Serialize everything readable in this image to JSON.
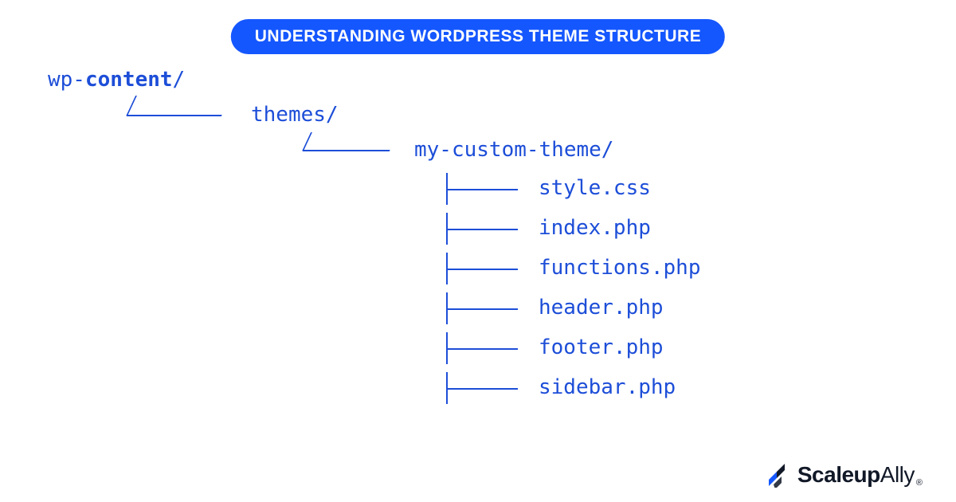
{
  "title": "UNDERSTANDING WORDPRESS THEME STRUCTURE",
  "tree": {
    "root_prefix": "wp-",
    "root_bold": "content",
    "root_suffix": "/",
    "level1": "themes/",
    "level2": "my-custom-theme/",
    "files": [
      "style.css",
      "index.php",
      "functions.php",
      "header.php",
      "footer.php",
      "sidebar.php"
    ]
  },
  "brand": {
    "part1": "Scaleup",
    "part2": "Ally",
    "reg": "®"
  },
  "colors": {
    "accent": "#1557ff",
    "text": "#1d4ed8"
  }
}
